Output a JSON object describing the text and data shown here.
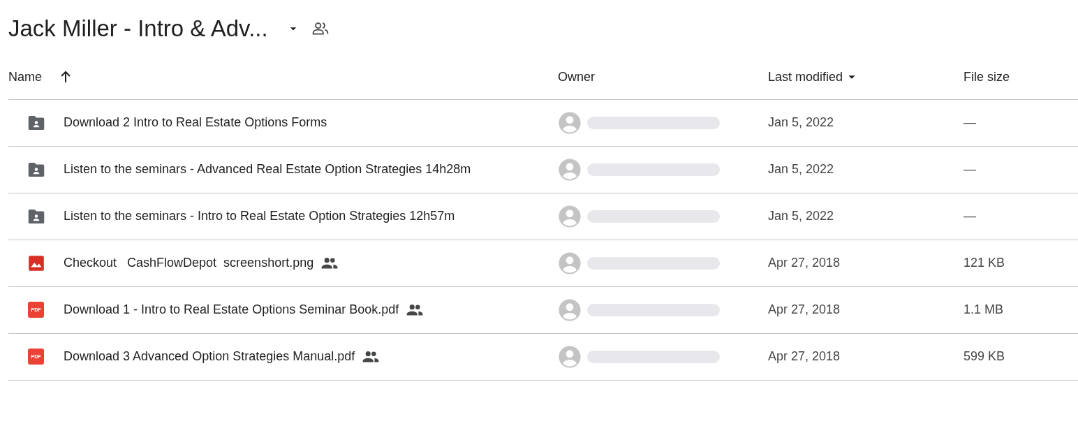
{
  "title": "Jack Miller - Intro & Adv...",
  "columns": [
    {
      "label": "Name",
      "sort_arrow": true,
      "dropdown": false
    },
    {
      "label": "Owner",
      "sort_arrow": false,
      "dropdown": false
    },
    {
      "label": "Last modified",
      "sort_arrow": false,
      "dropdown": true
    },
    {
      "label": "File size",
      "sort_arrow": false,
      "dropdown": false
    }
  ],
  "rows": [
    {
      "kind": "folder",
      "name": "Download 2 Intro to Real Estate Options Forms",
      "shared": false,
      "modified": "Jan 5, 2022",
      "size": "—"
    },
    {
      "kind": "folder",
      "name": "Listen to the seminars - Advanced Real Estate Option Strategies 14h28m",
      "shared": false,
      "modified": "Jan 5, 2022",
      "size": "—"
    },
    {
      "kind": "folder",
      "name": "Listen to the seminars - Intro to Real Estate Option Strategies 12h57m",
      "shared": false,
      "modified": "Jan 5, 2022",
      "size": "—"
    },
    {
      "kind": "image",
      "name": "Checkout   CashFlowDepot  screenshort.png",
      "shared": true,
      "modified": "Apr 27, 2018",
      "size": "121 KB"
    },
    {
      "kind": "pdf",
      "icon_label": "PDF",
      "name": "Download 1 - Intro to Real Estate Options Seminar Book.pdf",
      "shared": true,
      "modified": "Apr 27, 2018",
      "size": "1.1 MB"
    },
    {
      "kind": "pdf",
      "icon_label": "PDF",
      "name": "Download 3 Advanced Option Strategies Manual.pdf",
      "shared": true,
      "modified": "Apr 27, 2018",
      "size": "599 KB"
    }
  ]
}
